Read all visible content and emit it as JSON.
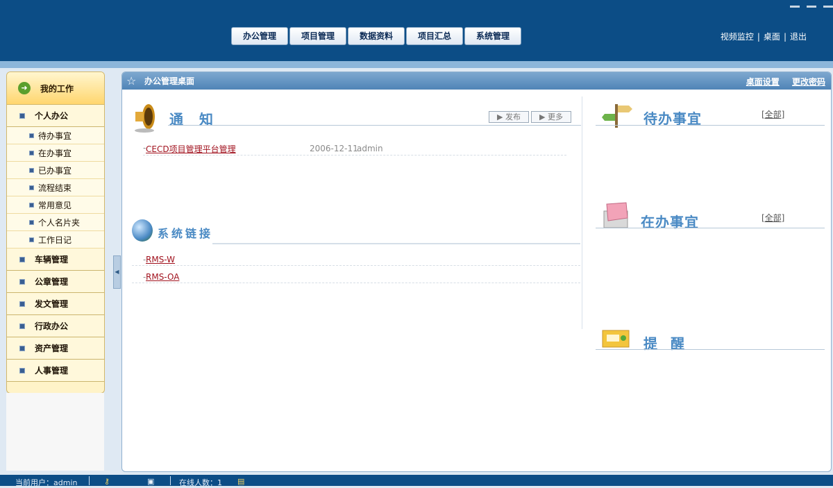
{
  "topnav": {
    "items": [
      "办公管理",
      "项目管理",
      "数据资料",
      "项目汇总",
      "系统管理"
    ],
    "right_links": [
      "视频监控",
      "桌面",
      "退出"
    ]
  },
  "sidebar": {
    "header": "我的工作",
    "groups": [
      {
        "label": "个人办公",
        "children": [
          "待办事宜",
          "在办事宜",
          "已办事宜",
          "流程结束",
          "常用意见",
          "个人名片夹",
          "工作日记"
        ]
      },
      {
        "label": "车辆管理"
      },
      {
        "label": "公章管理"
      },
      {
        "label": "发文管理"
      },
      {
        "label": "行政办公"
      },
      {
        "label": "资产管理"
      },
      {
        "label": "人事管理"
      }
    ]
  },
  "main": {
    "title": "办公管理桌面",
    "links": [
      "桌面设置",
      "更改密码"
    ],
    "notice": {
      "title": "通 知",
      "publish_btn": "发布",
      "more_btn": "更多",
      "items": [
        {
          "title": "CECD项目管理平台管理",
          "date": "2006-12-11",
          "author": "admin"
        }
      ]
    },
    "system_links": {
      "title": "系统链接",
      "items": [
        "RMS-W",
        "RMS-OA"
      ]
    },
    "todo": {
      "title": "待办事宜",
      "all": "[全部]"
    },
    "inprogress": {
      "title": "在办事宜",
      "all": "[全部]"
    },
    "reminder": {
      "title": "提 醒"
    }
  },
  "statusbar": {
    "current_user": "当前用户：admin",
    "online_count": "在线人数：1"
  }
}
